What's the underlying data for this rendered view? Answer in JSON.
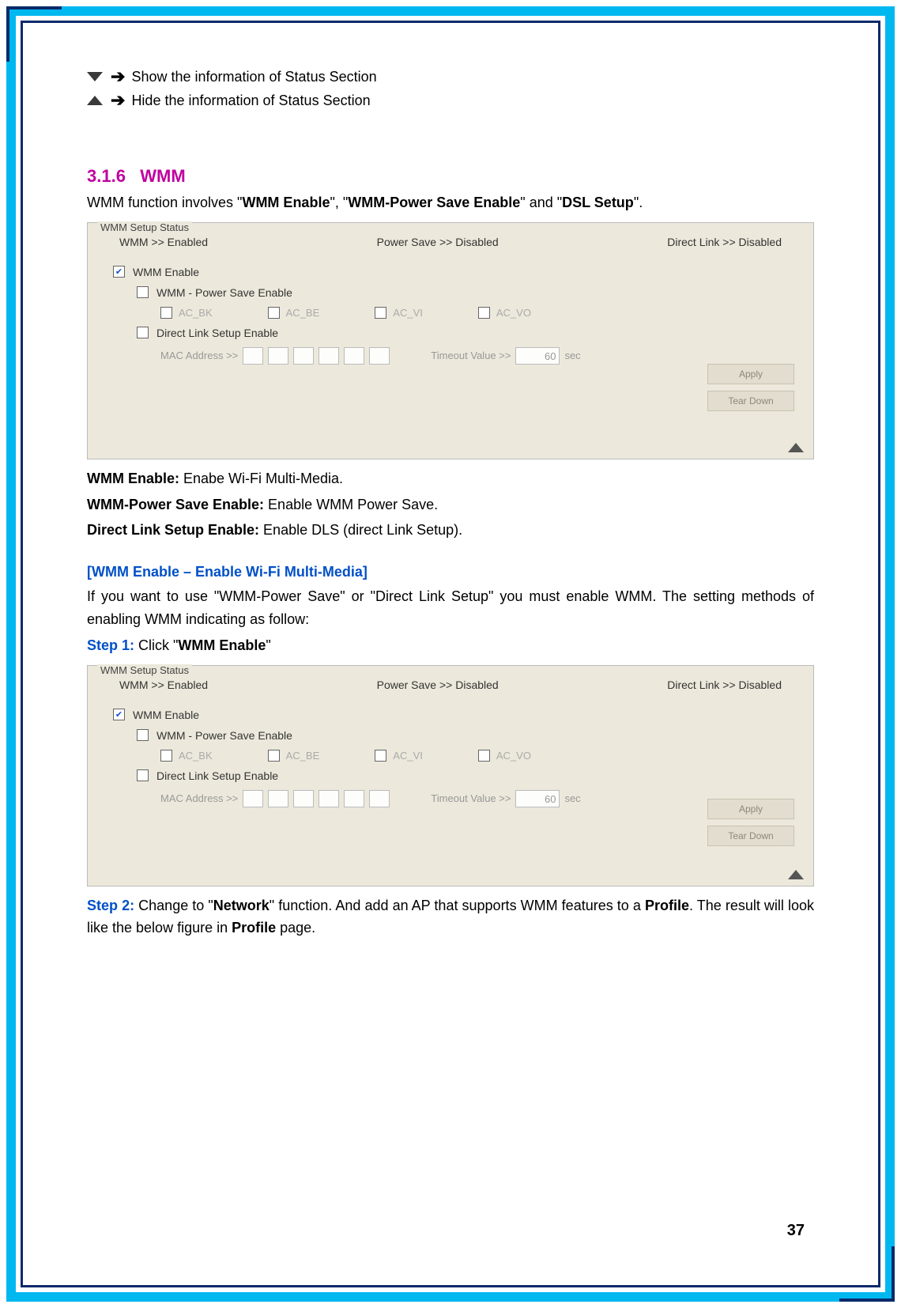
{
  "legend": {
    "show": "Show the information of Status Section",
    "hide": "Hide the information of Status Section"
  },
  "section": {
    "number": "3.1.6",
    "title": "WMM"
  },
  "intro": {
    "prefix": "WMM function involves \"",
    "b1": "WMM Enable",
    "mid1": "\", \"",
    "b2": "WMM-Power Save Enable",
    "mid2": "\" and \"",
    "b3": "DSL Setup",
    "suffix": "\"."
  },
  "panel": {
    "legend": "WMM Setup Status",
    "status": {
      "wmm": "WMM >> Enabled",
      "power": "Power Save >> Disabled",
      "direct": "Direct Link >> Disabled"
    },
    "labels": {
      "wmm_enable": "WMM Enable",
      "power_save_enable": "WMM - Power Save Enable",
      "ac_bk": "AC_BK",
      "ac_be": "AC_BE",
      "ac_vi": "AC_VI",
      "ac_vo": "AC_VO",
      "dls_enable": "Direct Link Setup Enable",
      "mac": "MAC Address >>",
      "timeout": "Timeout Value >>",
      "timeout_val": "60",
      "sec": "sec",
      "apply": "Apply",
      "teardown": "Tear Down"
    }
  },
  "defs": {
    "l1b": "WMM Enable:",
    "l1t": " Enabe Wi-Fi Multi-Media.",
    "l2b": "WMM-Power Save Enable:",
    "l2t": " Enable WMM Power Save.",
    "l3b": "Direct Link Setup Enable:",
    "l3t": " Enable DLS (direct Link Setup)."
  },
  "sub1": {
    "heading": "[WMM Enable – Enable Wi-Fi Multi-Media]",
    "para": "If you want to use \"WMM-Power Save\" or \"Direct Link Setup\" you must enable WMM. The setting methods of enabling WMM indicating as follow:",
    "step1_label": "Step 1:",
    "step1_a": " Click \"",
    "step1_b": "WMM Enable",
    "step1_c": "\""
  },
  "step2": {
    "label": "Step 2:",
    "a": " Change to \"",
    "b1": "Network",
    "c": "\" function. And add an AP that supports WMM features to a ",
    "b2": "Profile",
    "d": ". The result will look like the below figure in ",
    "b3": "Profile",
    "e": " page."
  },
  "page_number": "37"
}
